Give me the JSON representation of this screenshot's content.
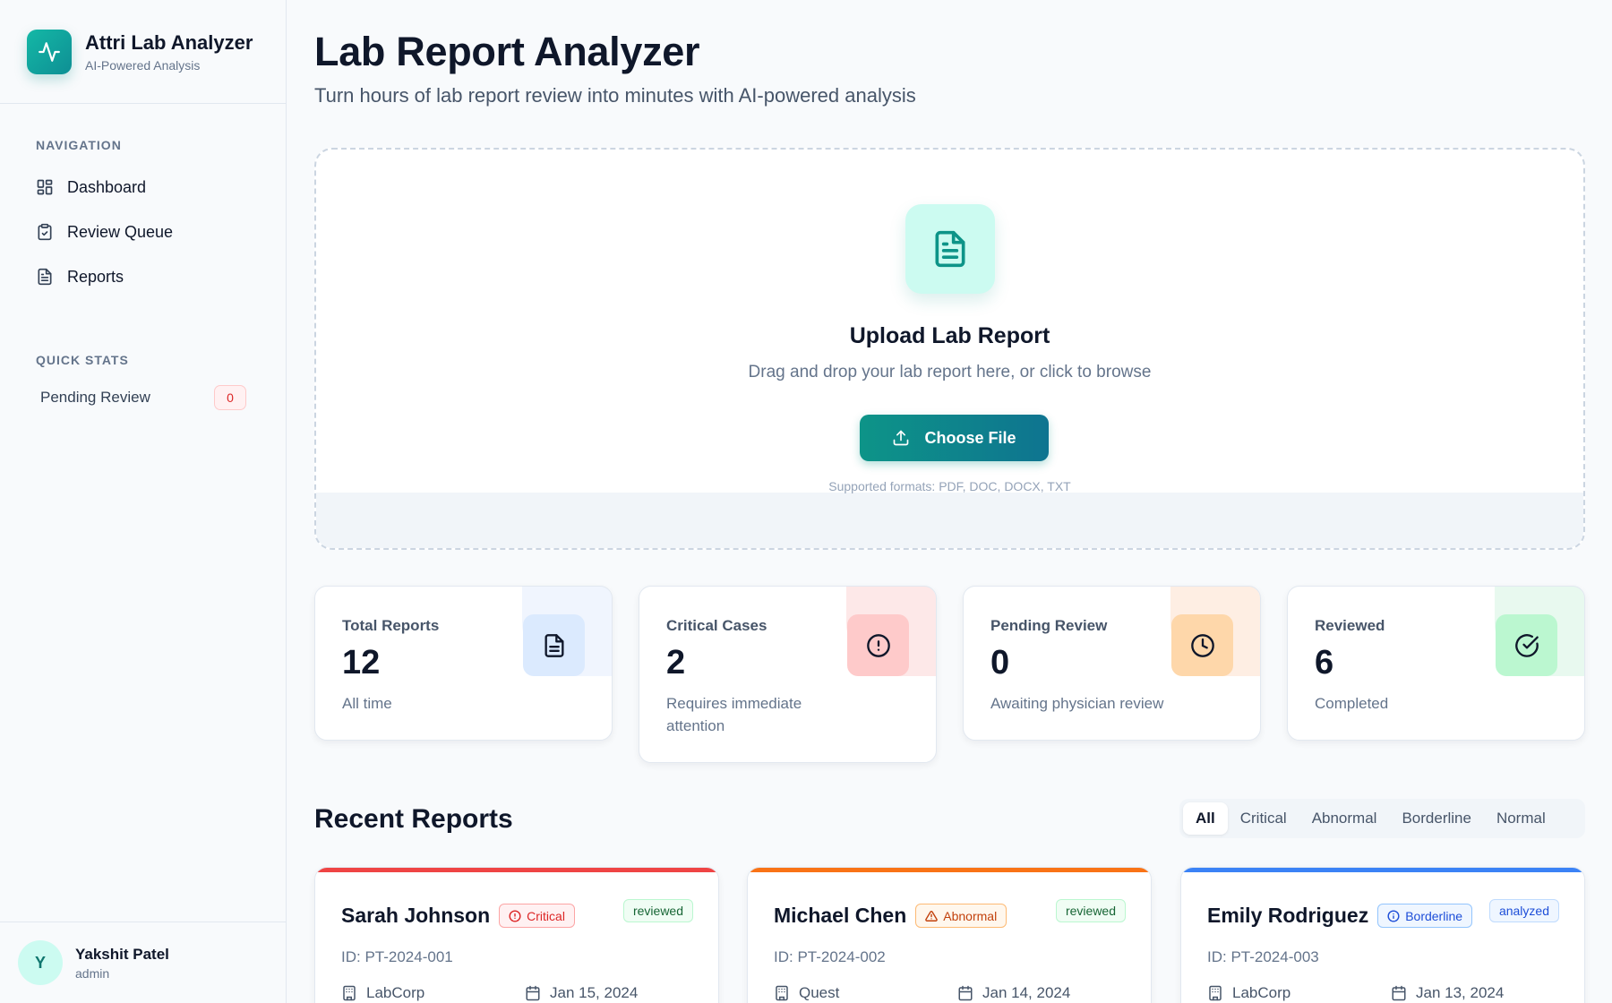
{
  "brand": {
    "name": "Attri Lab Analyzer",
    "subtitle": "AI-Powered Analysis",
    "logo_icon": "activity-icon"
  },
  "sidebar": {
    "nav_heading": "NAVIGATION",
    "items": [
      {
        "label": "Dashboard",
        "icon": "grid-icon"
      },
      {
        "label": "Review Queue",
        "icon": "clipboard-check-icon"
      },
      {
        "label": "Reports",
        "icon": "file-text-icon"
      }
    ],
    "quick_heading": "QUICK STATS",
    "quick_stats": [
      {
        "label": "Pending Review",
        "value": "0"
      }
    ]
  },
  "user": {
    "initial": "Y",
    "name": "Yakshit Patel",
    "role": "admin"
  },
  "header": {
    "title": "Lab Report Analyzer",
    "subtitle": "Turn hours of lab report review into minutes with AI-powered analysis"
  },
  "upload": {
    "title": "Upload Lab Report",
    "description": "Drag and drop your lab report here, or click to browse",
    "button_label": "Choose File",
    "formats": "Supported formats: PDF, DOC, DOCX, TXT"
  },
  "stats": [
    {
      "label": "Total Reports",
      "value": "12",
      "note": "All time",
      "icon": "file-text-icon",
      "color": "#3b82f6"
    },
    {
      "label": "Critical Cases",
      "value": "2",
      "note": "Requires immediate attention",
      "icon": "alert-circle-icon",
      "color": "#ef4444"
    },
    {
      "label": "Pending Review",
      "value": "0",
      "note": "Awaiting physician review",
      "icon": "clock-icon",
      "color": "#f97316"
    },
    {
      "label": "Reviewed",
      "value": "6",
      "note": "Completed",
      "icon": "check-circle-icon",
      "color": "#22c55e"
    }
  ],
  "recent": {
    "title": "Recent Reports",
    "filters": [
      "All",
      "Critical",
      "Abnormal",
      "Borderline",
      "Normal"
    ],
    "active_filter": "All",
    "cards": [
      {
        "name": "Sarah Johnson",
        "severity": "Critical",
        "status": "reviewed",
        "id": "ID: PT-2024-001",
        "lab": "LabCorp",
        "date": "Jan 15, 2024",
        "accent": "#ef4444"
      },
      {
        "name": "Michael Chen",
        "severity": "Abnormal",
        "status": "reviewed",
        "id": "ID: PT-2024-002",
        "lab": "Quest",
        "date": "Jan 14, 2024",
        "accent": "#f97316"
      },
      {
        "name": "Emily Rodriguez",
        "severity": "Borderline",
        "status": "analyzed",
        "id": "ID: PT-2024-003",
        "lab": "LabCorp",
        "date": "Jan 13, 2024",
        "accent": "#3b82f6"
      }
    ]
  }
}
